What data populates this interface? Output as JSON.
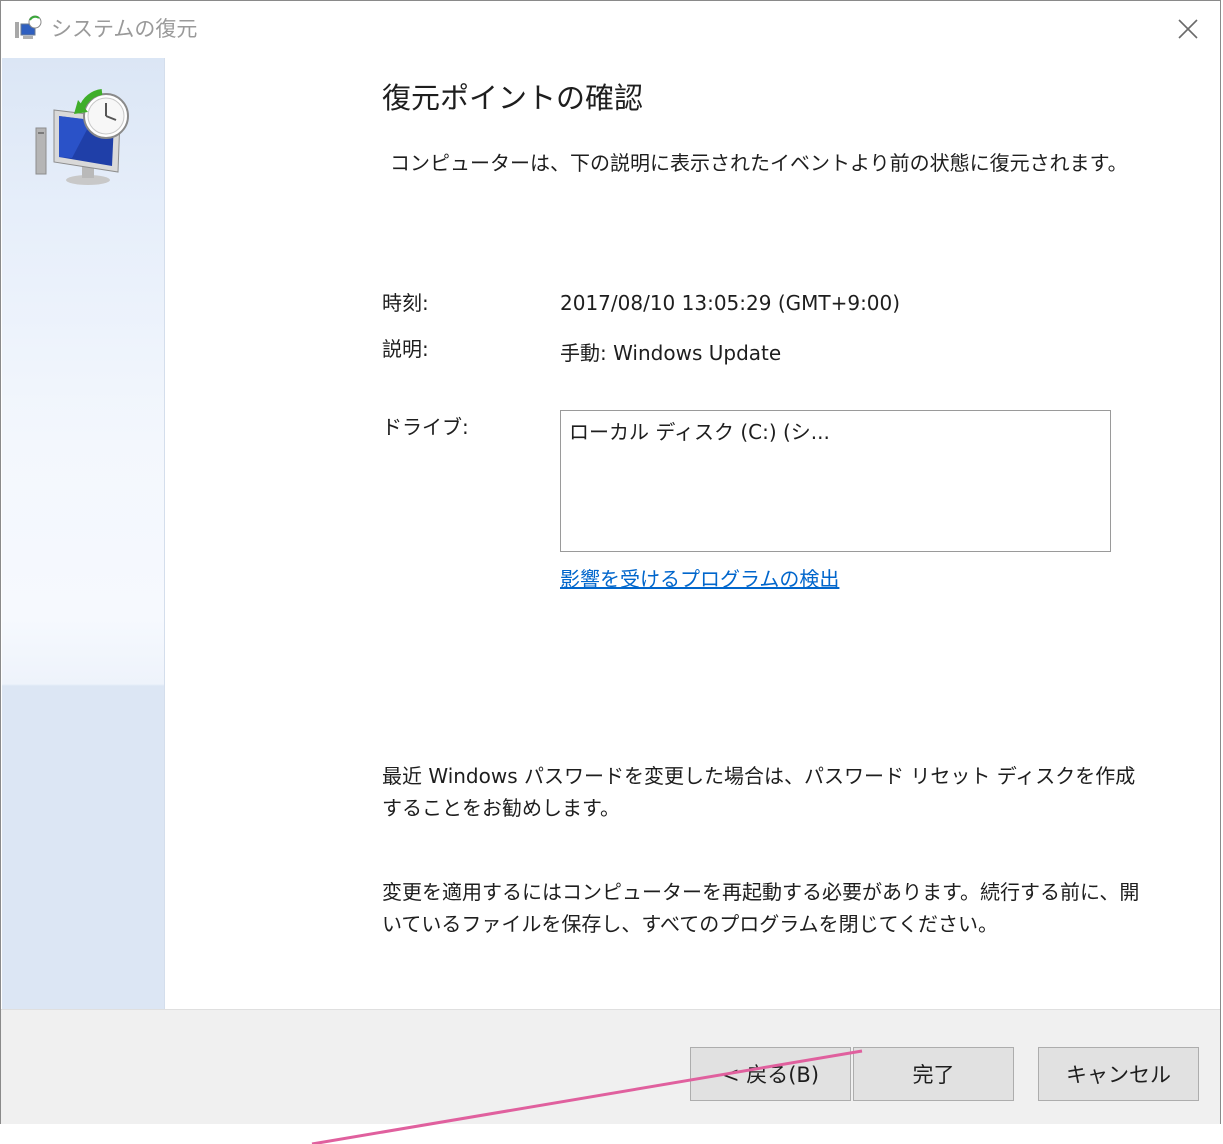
{
  "window": {
    "title": "システムの復元",
    "title_icon": "system-restore-icon",
    "close_icon": "close-icon"
  },
  "sidebar": {
    "icon": "computer-restore-clock-icon"
  },
  "main": {
    "heading": "復元ポイントの確認",
    "subtitle": "コンピューターは、下の説明に表示されたイベントより前の状態に復元されます。",
    "time_label": "時刻:",
    "time_value": "2017/08/10 13:05:29 (GMT+9:00)",
    "description_label": "説明:",
    "description_value": "手動: Windows Update",
    "drive_label": "ドライブ:",
    "drive_value": "ローカル ディスク (C:) (シ...",
    "affected_programs_link": "影響を受けるプログラムの検出",
    "password_note": "最近 Windows パスワードを変更した場合は、パスワード リセット ディスクを作成することをお勧めします。",
    "restart_note": "変更を適用するにはコンピューターを再起動する必要があります。続行する前に、開いているファイルを保存し、すべてのプログラムを閉じてください。"
  },
  "footer": {
    "back_label": "< 戻る(B)",
    "finish_label": "完了",
    "cancel_label": "キャンセル"
  },
  "colors": {
    "link": "#0066cc",
    "annotation_line": "#e0609e",
    "sidebar": "#dce6f4"
  }
}
